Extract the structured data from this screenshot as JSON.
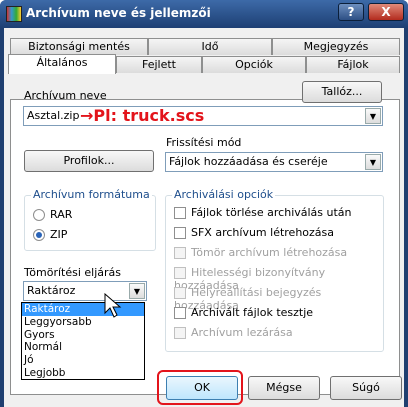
{
  "window": {
    "title": "Archívum neve és jellemzői",
    "help_label": "?",
    "close_label": "X"
  },
  "tabs_row1": [
    "Biztonsági mentés",
    "Idő",
    "Megjegyzés"
  ],
  "tabs_row2": [
    "Általános",
    "Fejlett",
    "Opciók",
    "Fájlok"
  ],
  "archive_name": {
    "label": "Archívum neve",
    "browse_label": "Tallóz...",
    "value": "Asztal.zip"
  },
  "annotation": {
    "text": "→Pl: truck.scs"
  },
  "profiles_label": "Profilok...",
  "update_mode": {
    "label": "Frissítési mód",
    "value": "Fájlok hozzáadása és cseréje"
  },
  "archive_format": {
    "title": "Archívum formátuma",
    "rar": "RAR",
    "zip": "ZIP",
    "selected": "ZIP"
  },
  "archive_options": {
    "title": "Archiválási opciók",
    "items": [
      {
        "label": "Fájlok törlése archiválás után",
        "enabled": true,
        "checked": false
      },
      {
        "label": "SFX archívum létrehozása",
        "enabled": true,
        "checked": false
      },
      {
        "label": "Tömör archívum létrehozása",
        "enabled": false,
        "checked": false
      },
      {
        "label": "Hitelességi bizonyítvány hozzáadása",
        "enabled": false,
        "checked": false
      },
      {
        "label": "Helyreállítási bejegyzés hozzáadása",
        "enabled": false,
        "checked": false
      },
      {
        "label": "Archivált fájlok tesztje",
        "enabled": true,
        "checked": false
      },
      {
        "label": "Archívum lezárása",
        "enabled": false,
        "checked": false
      }
    ]
  },
  "compression": {
    "label": "Tömörítési eljárás",
    "value": "Raktároz",
    "options": [
      "Raktároz",
      "Leggyorsabb",
      "Gyors",
      "Normál",
      "Jó",
      "Legjobb"
    ],
    "selected": "Raktároz"
  },
  "buttons": {
    "ok": "OK",
    "cancel": "Mégse",
    "help": "Súgó"
  },
  "colors": {
    "annotation": "#e3141b",
    "accent": "#2a64b8"
  }
}
